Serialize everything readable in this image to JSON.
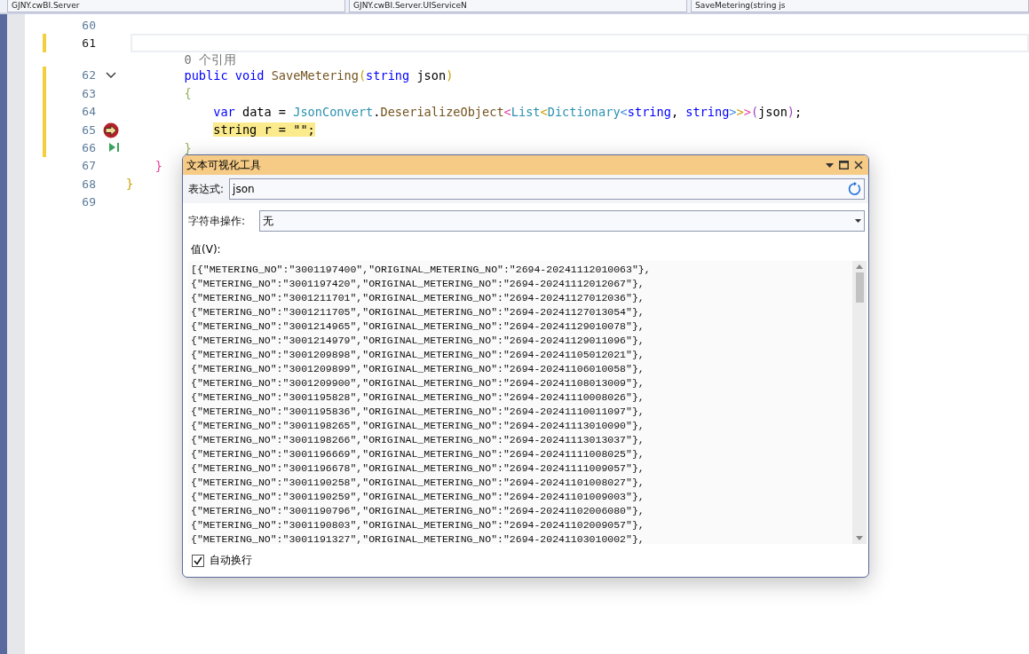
{
  "nav_bar": {
    "dropdowns": [
      "GJNY.cwBI.Server",
      "GJNY.cwBI.Server.UIServiceN",
      "SaveMetering(string js"
    ]
  },
  "editor": {
    "lines": [
      {
        "number": "60",
        "changed": false,
        "current_line": false
      },
      {
        "number": "61",
        "changed": true,
        "current_line": true
      },
      {
        "number": "62",
        "changed": true,
        "current_line": false,
        "lens": "0 个引用",
        "fold": {
          "expanded": true
        },
        "code": [
          {
            "text": "        public void ",
            "kind": "keyword"
          },
          {
            "text": "SaveMetering",
            "kind": "method"
          },
          {
            "text": "(",
            "kind": "brace1"
          },
          {
            "text": "string ",
            "kind": "keyword"
          },
          {
            "text": "json",
            "kind": "plain"
          },
          {
            "text": ")",
            "kind": "brace1"
          }
        ]
      },
      {
        "number": "63",
        "changed": true,
        "current_line": false,
        "code": [
          {
            "text": "        {",
            "kind": "brace2"
          }
        ]
      },
      {
        "number": "64",
        "changed": true,
        "current_line": false,
        "code": [
          {
            "text": "            var ",
            "kind": "keyword"
          },
          {
            "text": "data = ",
            "kind": "plain"
          },
          {
            "text": "JsonConvert",
            "kind": "type"
          },
          {
            "text": ".",
            "kind": "plain"
          },
          {
            "text": "DeserializeObject",
            "kind": "method"
          },
          {
            "text": "<",
            "kind": "brace3"
          },
          {
            "text": "List",
            "kind": "type"
          },
          {
            "text": "<",
            "kind": "brace1"
          },
          {
            "text": "Dictionary",
            "kind": "type"
          },
          {
            "text": "<",
            "kind": "brace4"
          },
          {
            "text": "string",
            "kind": "keyword"
          },
          {
            "text": ", ",
            "kind": "plain"
          },
          {
            "text": "string",
            "kind": "keyword"
          },
          {
            "text": ">",
            "kind": "brace4"
          },
          {
            "text": ">",
            "kind": "brace1"
          },
          {
            "text": ">",
            "kind": "brace3"
          },
          {
            "text": "(",
            "kind": "paren"
          },
          {
            "text": "json",
            "kind": "plain"
          },
          {
            "text": ")",
            "kind": "paren"
          },
          {
            "text": ";",
            "kind": "plain"
          }
        ]
      },
      {
        "number": "65",
        "changed": true,
        "current_line": false,
        "current_statement": true,
        "code": [
          {
            "text": "            string r = \"\";",
            "kind": "plain"
          }
        ]
      },
      {
        "number": "66",
        "changed": true,
        "current_line": false,
        "run_to_click": true,
        "code": [
          {
            "text": "        }",
            "kind": "brace2"
          }
        ]
      },
      {
        "number": "67",
        "changed": false,
        "current_line": false,
        "code": [
          {
            "text": "    }",
            "kind": "brace3"
          }
        ]
      },
      {
        "number": "68",
        "changed": false,
        "current_line": false,
        "code": [
          {
            "text": "}",
            "kind": "brace1"
          }
        ]
      },
      {
        "number": "69",
        "changed": false,
        "current_line": false
      }
    ]
  },
  "visualizer": {
    "title": "文本可视化工具",
    "expression": {
      "label": "表达式:",
      "value": "json"
    },
    "string_operation": {
      "label": "字符串操作:",
      "value": "无"
    },
    "value_label": "值(V):",
    "value_lines": [
      "[{\"METERING_NO\":\"3001197400\",\"ORIGINAL_METERING_NO\":\"2694-20241112010063\"},",
      "{\"METERING_NO\":\"3001197420\",\"ORIGINAL_METERING_NO\":\"2694-20241112012067\"},",
      "{\"METERING_NO\":\"3001211701\",\"ORIGINAL_METERING_NO\":\"2694-20241127012036\"},",
      "{\"METERING_NO\":\"3001211705\",\"ORIGINAL_METERING_NO\":\"2694-20241127013054\"},",
      "{\"METERING_NO\":\"3001214965\",\"ORIGINAL_METERING_NO\":\"2694-20241129010078\"},",
      "{\"METERING_NO\":\"3001214979\",\"ORIGINAL_METERING_NO\":\"2694-20241129011096\"},",
      "{\"METERING_NO\":\"3001209898\",\"ORIGINAL_METERING_NO\":\"2694-20241105012021\"},",
      "{\"METERING_NO\":\"3001209899\",\"ORIGINAL_METERING_NO\":\"2694-20241106010058\"},",
      "{\"METERING_NO\":\"3001209900\",\"ORIGINAL_METERING_NO\":\"2694-20241108013009\"},",
      "{\"METERING_NO\":\"3001195828\",\"ORIGINAL_METERING_NO\":\"2694-20241110008026\"},",
      "{\"METERING_NO\":\"3001195836\",\"ORIGINAL_METERING_NO\":\"2694-20241110011097\"},",
      "{\"METERING_NO\":\"3001198265\",\"ORIGINAL_METERING_NO\":\"2694-20241113010090\"},",
      "{\"METERING_NO\":\"3001198266\",\"ORIGINAL_METERING_NO\":\"2694-20241113013037\"},",
      "{\"METERING_NO\":\"3001196669\",\"ORIGINAL_METERING_NO\":\"2694-20241111008025\"},",
      "{\"METERING_NO\":\"3001196678\",\"ORIGINAL_METERING_NO\":\"2694-20241111009057\"},",
      "{\"METERING_NO\":\"3001190258\",\"ORIGINAL_METERING_NO\":\"2694-20241101008027\"},",
      "{\"METERING_NO\":\"3001190259\",\"ORIGINAL_METERING_NO\":\"2694-20241101009003\"},",
      "{\"METERING_NO\":\"3001190796\",\"ORIGINAL_METERING_NO\":\"2694-20241102006080\"},",
      "{\"METERING_NO\":\"3001190803\",\"ORIGINAL_METERING_NO\":\"2694-20241102009057\"},",
      "{\"METERING_NO\":\"3001191327\",\"ORIGINAL_METERING_NO\":\"2694-20241103010002\"},"
    ],
    "word_wrap": {
      "label": "自动换行",
      "checked": true
    }
  }
}
